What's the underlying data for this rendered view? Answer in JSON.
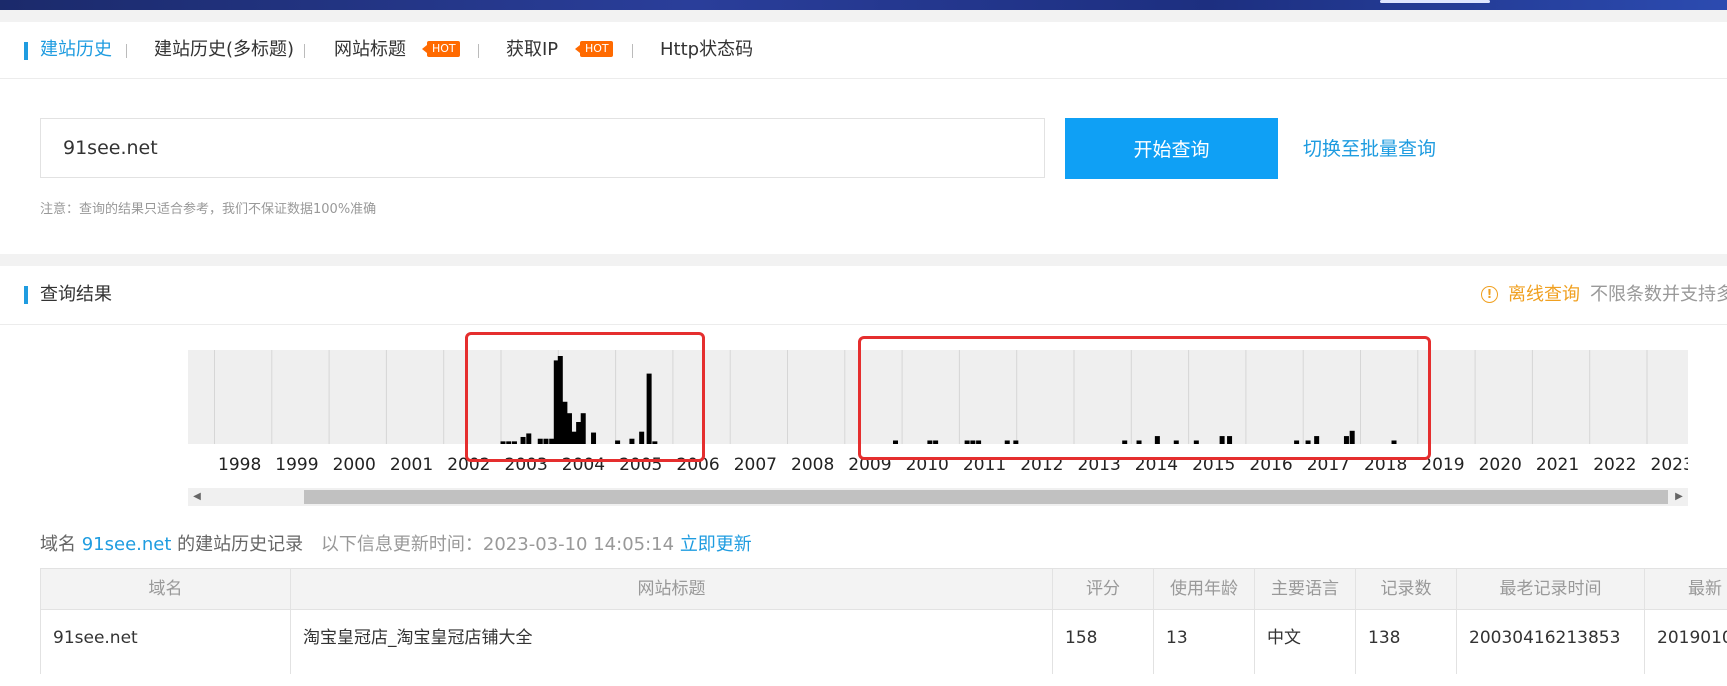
{
  "tabs": {
    "items": [
      {
        "label": "建站历史",
        "active": true
      },
      {
        "label": "建站历史(多标题)"
      },
      {
        "label": "网站标题",
        "badge": "HOT"
      },
      {
        "label": "获取IP",
        "badge": "HOT"
      },
      {
        "label": "Http状态码"
      }
    ]
  },
  "search": {
    "value": "91see.net",
    "button_label": "开始查询",
    "batch_link": "切换至批量查询",
    "notice": "注意：查询的结果只适合参考，我们不保证数据100%准确"
  },
  "results": {
    "title": "查询结果",
    "offline_icon": "info-icon",
    "offline_link": "离线查询",
    "offline_desc": "不限条数并支持多"
  },
  "chart_data": {
    "type": "bar",
    "x_tick_labels": [
      "'",
      "1998",
      "1999",
      "2000",
      "2001",
      "2002",
      "2003",
      "2004",
      "2005",
      "2006",
      "2007",
      "2008",
      "2009",
      "2010",
      "2011",
      "2012",
      "2013",
      "2014",
      "2015",
      "2016",
      "2017",
      "2018",
      "2019",
      "2020",
      "2021",
      "2022",
      "2023"
    ],
    "grid": true,
    "bar_color": "#000000",
    "background": "#efefef",
    "note": "",
    "bars": [
      {
        "year": 2003.0,
        "value": 3
      },
      {
        "year": 2003.1,
        "value": 3
      },
      {
        "year": 2003.2,
        "value": 3
      },
      {
        "year": 2003.35,
        "value": 8
      },
      {
        "year": 2003.45,
        "value": 12
      },
      {
        "year": 2003.65,
        "value": 6
      },
      {
        "year": 2003.75,
        "value": 6
      },
      {
        "year": 2003.85,
        "value": 6
      },
      {
        "year": 2003.93,
        "value": 95
      },
      {
        "year": 2004.0,
        "value": 100
      },
      {
        "year": 2004.08,
        "value": 48
      },
      {
        "year": 2004.16,
        "value": 35
      },
      {
        "year": 2004.24,
        "value": 14
      },
      {
        "year": 2004.32,
        "value": 25
      },
      {
        "year": 2004.4,
        "value": 35
      },
      {
        "year": 2004.58,
        "value": 13
      },
      {
        "year": 2005.0,
        "value": 4
      },
      {
        "year": 2005.25,
        "value": 6
      },
      {
        "year": 2005.42,
        "value": 14
      },
      {
        "year": 2005.55,
        "value": 80
      },
      {
        "year": 2005.65,
        "value": 3
      },
      {
        "year": 2009.85,
        "value": 4
      },
      {
        "year": 2010.45,
        "value": 4
      },
      {
        "year": 2010.55,
        "value": 4
      },
      {
        "year": 2011.1,
        "value": 4
      },
      {
        "year": 2011.2,
        "value": 4
      },
      {
        "year": 2011.3,
        "value": 4
      },
      {
        "year": 2011.8,
        "value": 4
      },
      {
        "year": 2011.95,
        "value": 4
      },
      {
        "year": 2013.85,
        "value": 4
      },
      {
        "year": 2014.1,
        "value": 4
      },
      {
        "year": 2014.42,
        "value": 9
      },
      {
        "year": 2014.75,
        "value": 4
      },
      {
        "year": 2015.1,
        "value": 4
      },
      {
        "year": 2015.55,
        "value": 9
      },
      {
        "year": 2015.68,
        "value": 9
      },
      {
        "year": 2016.85,
        "value": 4
      },
      {
        "year": 2017.05,
        "value": 4
      },
      {
        "year": 2017.2,
        "value": 9
      },
      {
        "year": 2017.72,
        "value": 9
      },
      {
        "year": 2017.82,
        "value": 15
      },
      {
        "year": 2018.55,
        "value": 4
      }
    ]
  },
  "history": {
    "prefix": "域名",
    "domain": "91see.net",
    "suffix": "的建站历史记录",
    "update_label": "以下信息更新时间：2023-03-10 14:05:14",
    "update_link": "立即更新"
  },
  "table": {
    "headers": [
      "域名",
      "网站标题",
      "评分",
      "使用年龄",
      "主要语言",
      "记录数",
      "最老记录时间",
      "最新"
    ],
    "rows": [
      [
        "91see.net",
        "淘宝皇冠店_淘宝皇冠店铺大全",
        "158",
        "13",
        "中文",
        "138",
        "20030416213853",
        "2019010"
      ]
    ]
  }
}
